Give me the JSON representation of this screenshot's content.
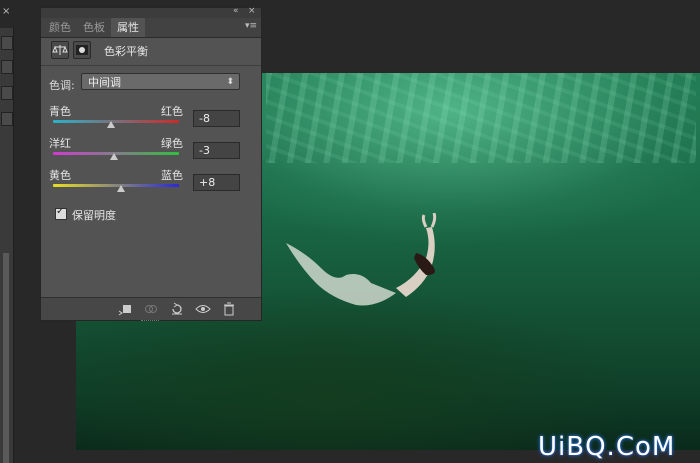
{
  "panel": {
    "tabs": [
      {
        "label": "颜色",
        "active": false
      },
      {
        "label": "色板",
        "active": false
      },
      {
        "label": "属性",
        "active": true
      }
    ],
    "title": "色彩平衡",
    "tone": {
      "label": "色调:",
      "value": "中间调"
    },
    "sliders": [
      {
        "left": "青色",
        "right": "红色",
        "value": "-8",
        "gradient": [
          "#29b3c9",
          "#cc2a2a"
        ],
        "position": 0.46
      },
      {
        "left": "洋红",
        "right": "绿色",
        "value": "-3",
        "gradient": [
          "#d23ad2",
          "#30c040"
        ],
        "position": 0.485
      },
      {
        "left": "黄色",
        "right": "蓝色",
        "value": "+8",
        "gradient": [
          "#e8e020",
          "#2a2ad8"
        ],
        "position": 0.54
      }
    ],
    "preserve_luminosity": {
      "label": "保留明度",
      "checked": true
    }
  },
  "watermark": {
    "text": "UiBQ.CoM"
  }
}
